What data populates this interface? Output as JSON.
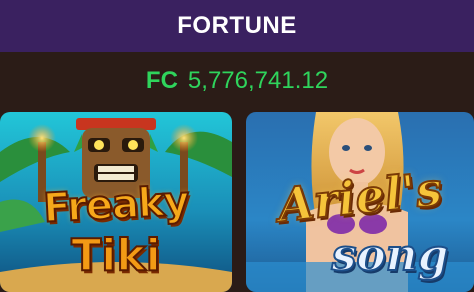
{
  "header": {
    "title": "FORTUNE"
  },
  "balance": {
    "currency": "FC",
    "amount": "5,776,741.12"
  },
  "games": [
    {
      "title_line1": "Freaky",
      "title_line2": "Tiki"
    },
    {
      "title_line1": "Ariel's",
      "title_line2": "song"
    }
  ],
  "colors": {
    "header_bg": "#3a2160",
    "balance_bg": "#2b1c17",
    "balance_text": "#2fd45c"
  }
}
